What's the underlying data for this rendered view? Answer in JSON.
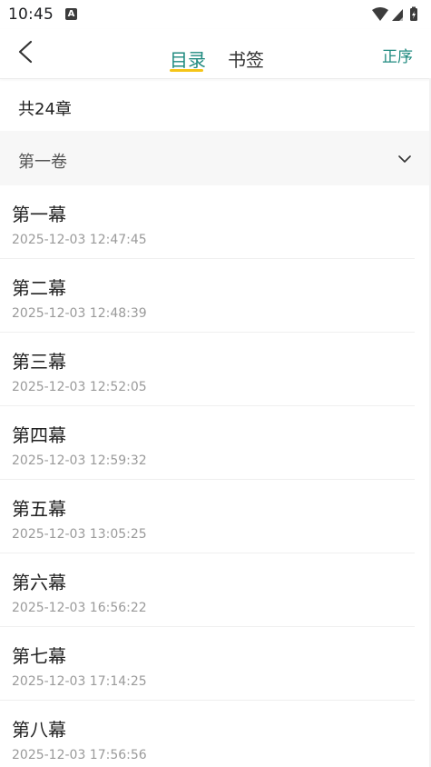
{
  "status_bar": {
    "time": "10:45",
    "a_icon_label": "A"
  },
  "header": {
    "tabs": [
      {
        "label": "目录",
        "active": true
      },
      {
        "label": "书签",
        "active": false
      }
    ],
    "sort_label": "正序"
  },
  "summary": {
    "chapter_count": "共24章"
  },
  "volume": {
    "label": "第一卷"
  },
  "chapters": [
    {
      "title": "第一幕",
      "time": "2025-12-03 12:47:45"
    },
    {
      "title": "第二幕",
      "time": "2025-12-03 12:48:39"
    },
    {
      "title": "第三幕",
      "time": "2025-12-03 12:52:05"
    },
    {
      "title": "第四幕",
      "time": "2025-12-03 12:59:32"
    },
    {
      "title": "第五幕",
      "time": "2025-12-03 13:05:25"
    },
    {
      "title": "第六幕",
      "time": "2025-12-03 16:56:22"
    },
    {
      "title": "第七幕",
      "time": "2025-12-03 17:14:25"
    },
    {
      "title": "第八幕",
      "time": "2025-12-03 17:56:56"
    }
  ],
  "colors": {
    "accent": "#1f8a7f",
    "tab_indicator": "#f5c518",
    "volume_bg": "#f7f7f7"
  }
}
